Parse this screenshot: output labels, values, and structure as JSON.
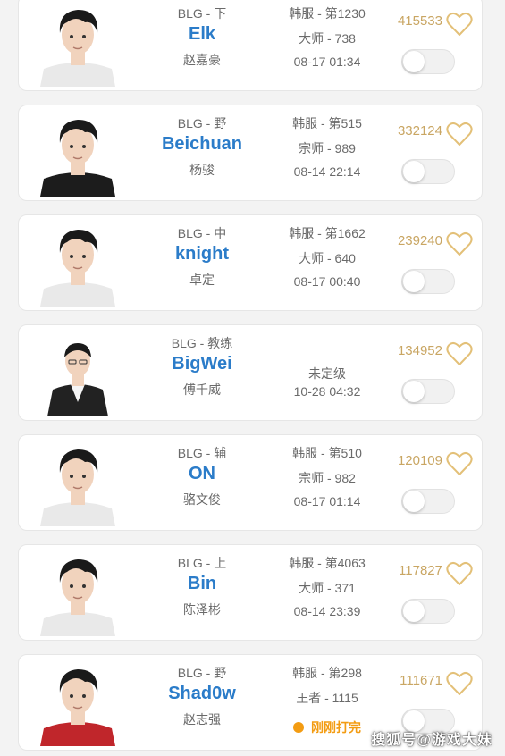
{
  "colors": {
    "name_blue": "#2b7cc9",
    "likes_gold": "#c9a663",
    "live_orange": "#f39c12",
    "text_gray": "#6a6a6a"
  },
  "players": [
    {
      "team_role": "BLG - 下",
      "name": "Elk",
      "real_name": "赵嘉豪",
      "rank_1": "韩服 - 第1230",
      "rank_2": "大师 - 738",
      "time": "08-17 01:34",
      "likes": "415533",
      "shirt": "#e9e9e9"
    },
    {
      "team_role": "BLG - 野",
      "name": "Beichuan",
      "real_name": "杨骏",
      "rank_1": "韩服 - 第515",
      "rank_2": "宗师 - 989",
      "time": "08-14 22:14",
      "likes": "332124",
      "shirt": "#1c1c1c"
    },
    {
      "team_role": "BLG - 中",
      "name": "knight",
      "real_name": "卓定",
      "rank_1": "韩服 - 第1662",
      "rank_2": "大师 - 640",
      "time": "08-17 00:40",
      "likes": "239240",
      "shirt": "#e9e9e9"
    },
    {
      "team_role": "BLG - 教练",
      "name": "BigWei",
      "real_name": "傅千威",
      "status": "未定级",
      "time": "10-28 04:32",
      "likes": "134952",
      "shirt": "#222222"
    },
    {
      "team_role": "BLG - 辅",
      "name": "ON",
      "real_name": "骆文俊",
      "rank_1": "韩服 - 第510",
      "rank_2": "宗师 - 982",
      "time": "08-17 01:14",
      "likes": "120109",
      "shirt": "#e9e9e9"
    },
    {
      "team_role": "BLG - 上",
      "name": "Bin",
      "real_name": "陈泽彬",
      "rank_1": "韩服 - 第4063",
      "rank_2": "大师 - 371",
      "time": "08-14 23:39",
      "likes": "117827",
      "shirt": "#e9e9e9"
    },
    {
      "team_role": "BLG - 野",
      "name": "Shad0w",
      "real_name": "赵志强",
      "rank_1": "韩服 - 第298",
      "rank_2": "王者 - 1115",
      "live": "刚刚打完",
      "likes": "111671",
      "shirt": "#c0262b"
    }
  ],
  "watermark": "搜狐号@游戏大妹"
}
